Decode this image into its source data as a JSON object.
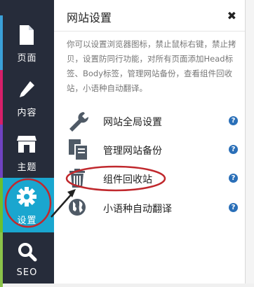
{
  "sidebar": {
    "items": [
      {
        "label": "页面",
        "icon": "page-icon",
        "stripe_color": "#3aa0d8"
      },
      {
        "label": "内容",
        "icon": "pencil-icon",
        "stripe_color": "#d61f69"
      },
      {
        "label": "主题",
        "icon": "store-icon",
        "stripe_color": "#6f42c1"
      },
      {
        "label": "设置",
        "icon": "gear-icon",
        "stripe_color": "#1aa6cf",
        "active": true
      },
      {
        "label": "SEO",
        "icon": "magnifier-icon",
        "stripe_color": "#8bc34a"
      }
    ]
  },
  "panel": {
    "title": "网站设置",
    "close_glyph": "✖",
    "description": "你可以设置浏览器图标，禁止鼠标右键，禁止拷贝，设置防同行功能，对所有页面添加Head标签、Body标签，管理网站备份，查看组件回收站，小语种自动翻译。",
    "items": [
      {
        "label": "网站全局设置",
        "icon": "wrench-icon"
      },
      {
        "label": "管理网站备份",
        "icon": "backup-icon"
      },
      {
        "label": "组件回收站",
        "icon": "trash-icon"
      },
      {
        "label": "小语种自动翻译",
        "icon": "globe-icon"
      }
    ],
    "help_glyph": "?"
  },
  "colors": {
    "sidebar_bg": "#262c3a",
    "active_bg": "#1aa6cf",
    "annotation": "#c0282d",
    "help": "#2a6fb8"
  }
}
